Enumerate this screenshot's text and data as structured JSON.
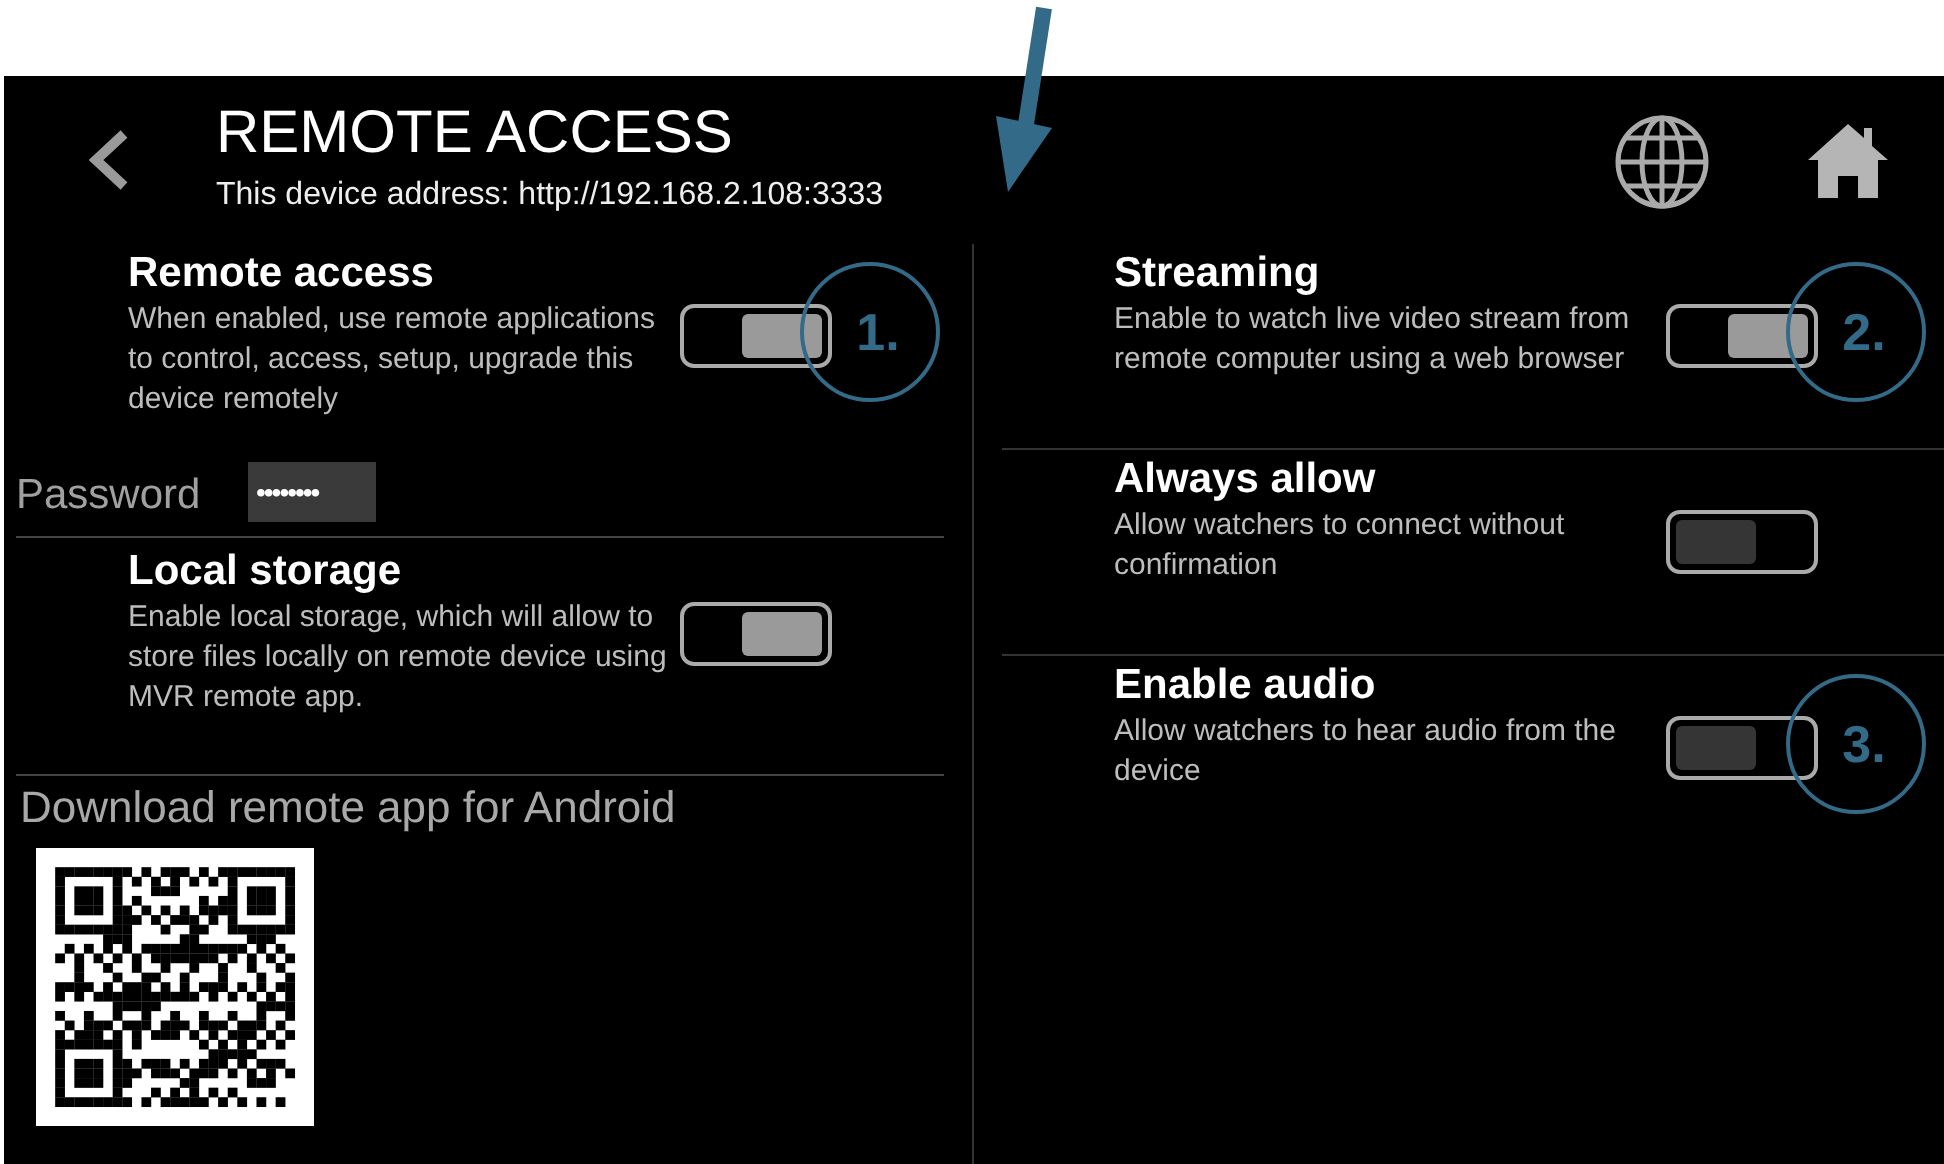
{
  "header": {
    "title": "REMOTE ACCESS",
    "address": "This device address: http://192.168.2.108:3333"
  },
  "left": {
    "remote_access": {
      "title": "Remote access",
      "description": "When enabled, use remote applications to control, access, setup, upgrade this device remotely",
      "on": true,
      "callout": "1."
    },
    "password": {
      "label": "Password",
      "value": "••••••••"
    },
    "local_storage": {
      "title": "Local storage",
      "description": "Enable local storage, which will allow to store files locally on remote device using MVR remote app.",
      "on": true
    },
    "download": {
      "label": "Download remote app for Android"
    }
  },
  "right": {
    "settings": [
      {
        "title": "Streaming",
        "description": "Enable to watch live video stream from remote computer using a web browser",
        "on": true,
        "callout": "2."
      },
      {
        "title": "Always allow",
        "description": "Allow watchers to connect without confirmation",
        "on": false
      },
      {
        "title": "Enable audio",
        "description": "Allow watchers to hear audio from the device",
        "on": false,
        "callout": "3."
      }
    ]
  }
}
